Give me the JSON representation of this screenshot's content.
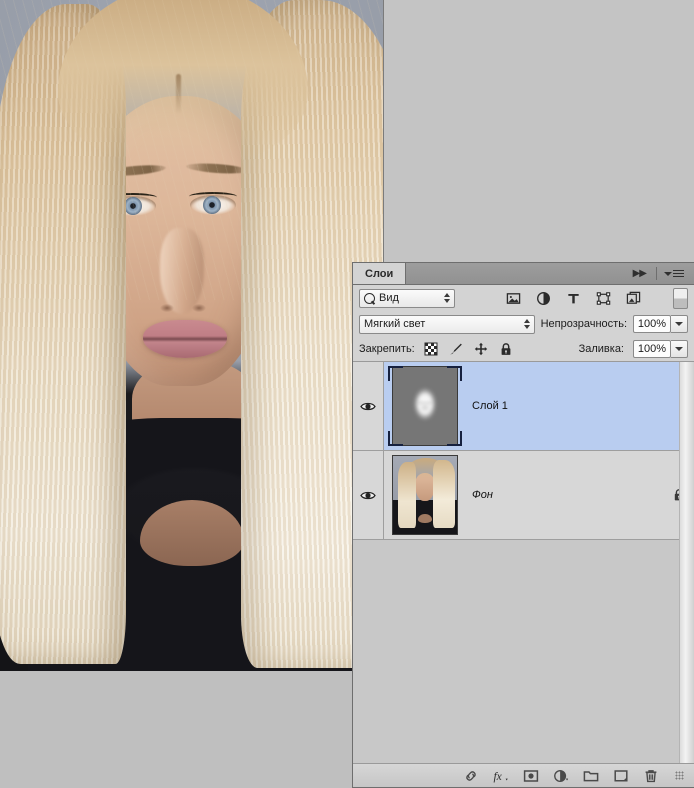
{
  "app": {
    "title": "Adobe Photoshop — Layers panel (Russian UI)"
  },
  "canvas": {
    "name": "portrait-photo",
    "description": "Studio portrait of a blonde woman on a gray-blue background",
    "background_color": "#9ba1ad"
  },
  "panel": {
    "tab_label": "Слои",
    "collapse_icon": "double-right-arrow-icon",
    "menu_icon": "panel-menu-icon",
    "filter": {
      "search_icon": "magnifier-icon",
      "selected": "Вид",
      "stepper_icon": "updown-stepper-icon",
      "type_icons": [
        {
          "name": "filter-pixel-icon",
          "title": "Пиксели"
        },
        {
          "name": "filter-adjustment-icon",
          "title": "Корректирующий"
        },
        {
          "name": "filter-type-icon",
          "title": "Текст"
        },
        {
          "name": "filter-shape-icon",
          "title": "Фигура"
        },
        {
          "name": "filter-smart-object-icon",
          "title": "Смарт-объект"
        }
      ],
      "toggle_name": "filter-enable-toggle"
    },
    "blend_mode": {
      "label": "Мягкий свет",
      "dropdown_icon": "updown-stepper-icon"
    },
    "opacity": {
      "label": "Непрозрачность:",
      "value": "100%",
      "dropdown_icon": "chevron-down-icon"
    },
    "fill": {
      "label": "Заливка:",
      "value": "100%",
      "dropdown_icon": "chevron-down-icon"
    },
    "lock": {
      "label": "Закрепить:",
      "icons": [
        {
          "name": "lock-transparency-icon",
          "title": "Закрепить прозрачные пиксели"
        },
        {
          "name": "lock-pixels-icon",
          "title": "Закрепить пиксели изображения"
        },
        {
          "name": "lock-position-icon",
          "title": "Закрепить положение"
        },
        {
          "name": "lock-all-icon",
          "title": "Закрепить все"
        }
      ]
    },
    "layers": [
      {
        "name": "Слой 1",
        "visible": true,
        "selected": true,
        "locked": false,
        "italic": false,
        "thumbnail": "gray-blurred-face-thumbnail",
        "eye_icon": "eye-icon"
      },
      {
        "name": "Фон",
        "visible": true,
        "selected": false,
        "locked": true,
        "italic": true,
        "thumbnail": "portrait-photo-thumbnail",
        "eye_icon": "eye-icon",
        "lock_icon": "padlock-icon"
      }
    ],
    "bottom_toolbar": [
      {
        "name": "link-layers-icon",
        "title": "Связать слои"
      },
      {
        "name": "layer-style-fx-icon",
        "title": "Стиль слоя",
        "label": "fx"
      },
      {
        "name": "add-layer-mask-icon",
        "title": "Добавить слой-маску"
      },
      {
        "name": "new-adjustment-layer-icon",
        "title": "Создать корректирующий слой"
      },
      {
        "name": "new-group-icon",
        "title": "Создать группу"
      },
      {
        "name": "new-layer-icon",
        "title": "Создать слой"
      },
      {
        "name": "delete-layer-icon",
        "title": "Удалить слой"
      }
    ],
    "resize_grip": "resize-grip-icon",
    "colors": {
      "panel_bg": "#d3d3d3",
      "list_bg": "#c8c8c8",
      "row_bg": "#d7d7d7",
      "selected_row": "#b9cdf0",
      "border": "#6e6e6e"
    }
  }
}
